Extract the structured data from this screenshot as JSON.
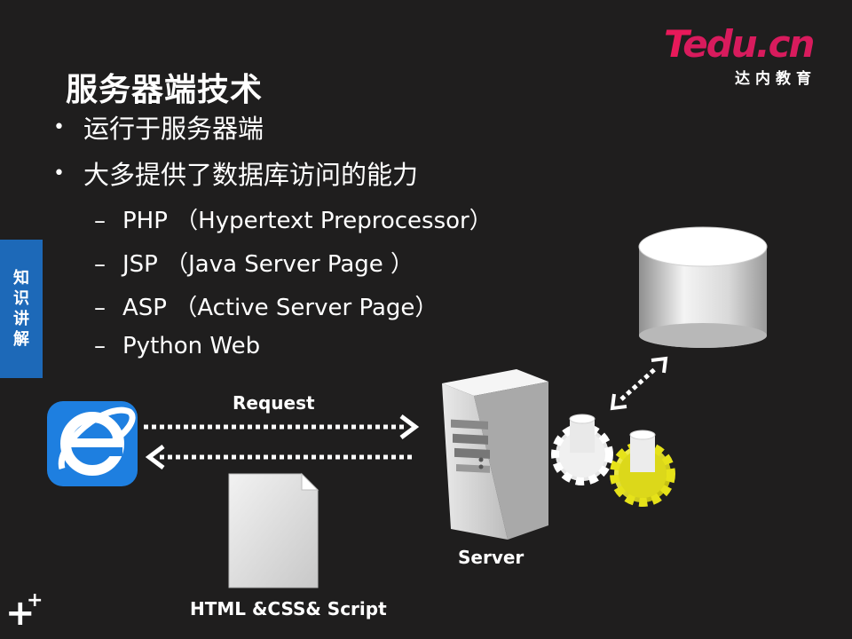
{
  "logo": {
    "main_t": "T",
    "main_rest": "edu.cn",
    "sub": "达内教育"
  },
  "title": "服务器端技术",
  "bullets": [
    {
      "marker": "•",
      "text": "运行于服务器端"
    },
    {
      "marker": "•",
      "text": "大多提供了数据库访问的能力"
    }
  ],
  "sub_items": [
    {
      "marker": "–",
      "text": "PHP （Hypertext Preprocessor）"
    },
    {
      "marker": "–",
      "text": "JSP （Java Server Page ）"
    },
    {
      "marker": "–",
      "text": "ASP （Active Server Page）"
    },
    {
      "marker": "–",
      "text": "Python Web"
    }
  ],
  "side_tab": [
    "知",
    "识",
    "讲",
    "解"
  ],
  "diagram": {
    "request_label": "Request",
    "server_label": "Server",
    "document_label": "HTML &CSS& Script"
  },
  "icons": {
    "browser": "internet-explorer-icon",
    "server": "server-tower-icon",
    "database": "database-cylinder-icon",
    "gears": "gears-icon",
    "document": "document-icon"
  },
  "colors": {
    "background": "#1f1e1e",
    "accent_blue": "#1d69b8",
    "brand_pink": "#e8195a",
    "gear_yellow": "#e6e219"
  }
}
